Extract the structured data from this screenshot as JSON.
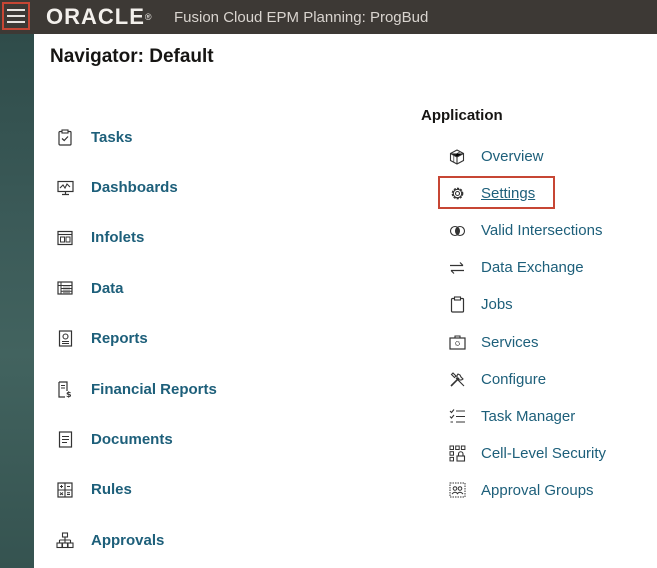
{
  "header": {
    "logo_text": "ORACLE",
    "logo_reg": "®",
    "product_title": "Fusion Cloud EPM Planning:  ProgBud",
    "accent_color": "#c74634",
    "bar_color": "#3d3935"
  },
  "navigator": {
    "title": "Navigator: Default"
  },
  "left_items": [
    {
      "label": "Tasks",
      "icon": "clipboard-check-icon"
    },
    {
      "label": "Dashboards",
      "icon": "monitor-chart-icon"
    },
    {
      "label": "Infolets",
      "icon": "infolet-icon"
    },
    {
      "label": "Data",
      "icon": "data-grid-icon"
    },
    {
      "label": "Reports",
      "icon": "report-icon"
    },
    {
      "label": "Financial Reports",
      "icon": "financial-report-icon"
    },
    {
      "label": "Documents",
      "icon": "document-icon"
    },
    {
      "label": "Rules",
      "icon": "rules-calculator-icon"
    },
    {
      "label": "Approvals",
      "icon": "hierarchy-icon"
    }
  ],
  "application": {
    "section_title": "Application",
    "items": [
      {
        "label": "Overview",
        "icon": "cube-icon"
      },
      {
        "label": "Settings",
        "icon": "gear-icon"
      },
      {
        "label": "Valid Intersections",
        "icon": "intersection-icon"
      },
      {
        "label": "Data Exchange",
        "icon": "exchange-arrows-icon"
      },
      {
        "label": "Jobs",
        "icon": "clipboard-icon"
      },
      {
        "label": "Services",
        "icon": "toolbox-icon"
      },
      {
        "label": "Configure",
        "icon": "tools-icon"
      },
      {
        "label": "Task Manager",
        "icon": "checklist-icon"
      },
      {
        "label": "Cell-Level Security",
        "icon": "cell-security-icon"
      },
      {
        "label": "Approval Groups",
        "icon": "approval-groups-icon"
      }
    ]
  }
}
